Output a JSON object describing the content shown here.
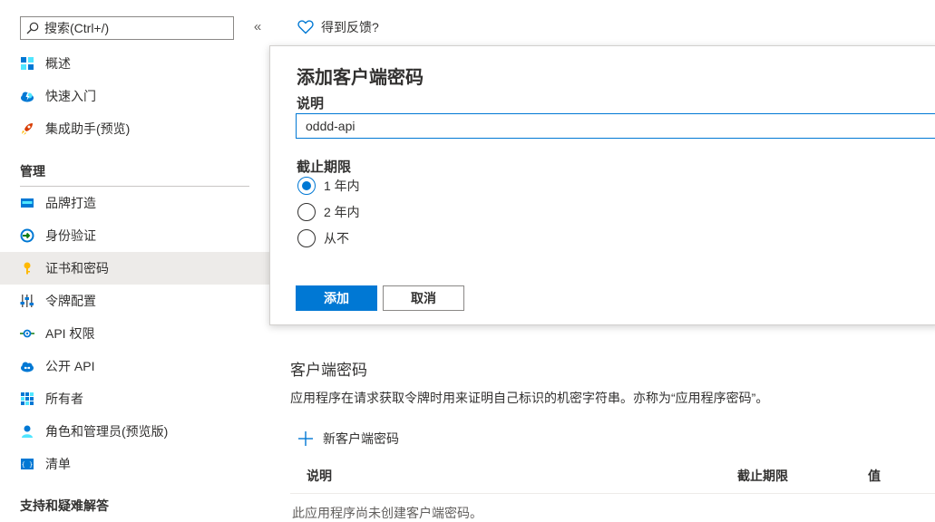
{
  "search": {
    "placeholder": "搜索(Ctrl+/)"
  },
  "sidebar": {
    "collapse": "«",
    "top_items": [
      {
        "label": "概述"
      },
      {
        "label": "快速入门"
      },
      {
        "label": "集成助手(预览)"
      }
    ],
    "manage_header": "管理",
    "manage_items": [
      {
        "label": "品牌打造"
      },
      {
        "label": "身份验证"
      },
      {
        "label": "证书和密码"
      },
      {
        "label": "令牌配置"
      },
      {
        "label": "API 权限"
      },
      {
        "label": "公开 API"
      },
      {
        "label": "所有者"
      },
      {
        "label": "角色和管理员(预览版)"
      },
      {
        "label": "清单"
      }
    ],
    "support_header": "支持和疑难解答"
  },
  "main": {
    "feedback": "得到反馈?",
    "panel": {
      "title": "添加客户端密码",
      "desc_label": "说明",
      "desc_value": "oddd-api",
      "expiry_label": "截止期限",
      "options": [
        "1 年内",
        "2 年内",
        "从不"
      ],
      "add_button": "添加",
      "cancel_button": "取消"
    },
    "secrets": {
      "title": "客户端密码",
      "description": "应用程序在请求获取令牌时用来证明自己标识的机密字符串。亦称为“应用程序密码”。",
      "new_button": "新客户端密码",
      "columns": [
        "说明",
        "截止期限",
        "值"
      ],
      "empty": "此应用程序尚未创建客户端密码。"
    }
  },
  "colors": {
    "accent": "#0078d4",
    "selected_bg": "#edebe9"
  }
}
